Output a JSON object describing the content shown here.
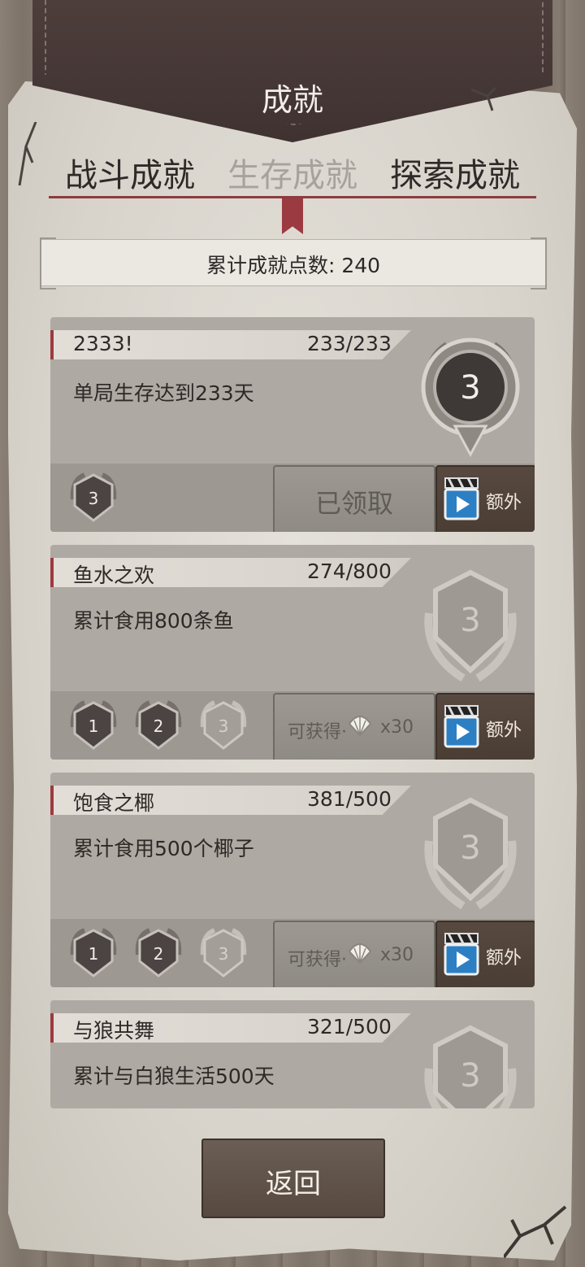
{
  "header": {
    "title": "成就"
  },
  "tabs": [
    {
      "label": "战斗成就",
      "active": false
    },
    {
      "label": "生存成就",
      "active": true
    },
    {
      "label": "探索成就",
      "active": false
    }
  ],
  "points": {
    "label": "累计成就点数: 240"
  },
  "achievements": [
    {
      "name": "2333!",
      "progress": "233/233",
      "desc": "单局生存达到233天",
      "medal_level": "3",
      "tiers": [
        "3"
      ],
      "status": "已领取",
      "extra": "额外"
    },
    {
      "name": "鱼水之欢",
      "progress": "274/800",
      "desc": "累计食用800条鱼",
      "medal_level": "3",
      "tiers": [
        "1",
        "2",
        "3"
      ],
      "reward_label": "可获得·",
      "reward_mult": "x30",
      "extra": "额外"
    },
    {
      "name": "饱食之椰",
      "progress": "381/500",
      "desc": "累计食用500个椰子",
      "medal_level": "3",
      "tiers": [
        "1",
        "2",
        "3"
      ],
      "reward_label": "可获得·",
      "reward_mult": "x30",
      "extra": "额外"
    },
    {
      "name": "与狼共舞",
      "progress": "321/500",
      "desc": "累计与白狼生活500天",
      "medal_level": "3"
    }
  ],
  "footer": {
    "back_label": "返回"
  },
  "icons": {
    "reward": "shell-icon",
    "extra": "video-clapper-icon"
  }
}
